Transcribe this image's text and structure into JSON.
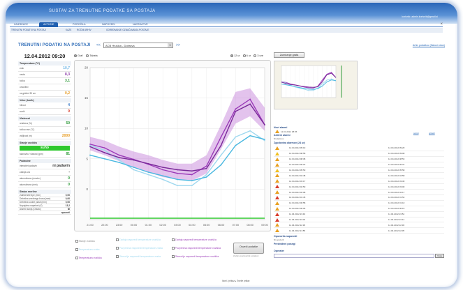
{
  "header": {
    "app_title": "SUSTAV ZA TRENUTNE PODATKE SA POSTAJA",
    "user_info": "korisnik: admin.korisnik@gmail.si"
  },
  "nav": {
    "items": [
      "ZAJEDNICE",
      "AKTIVNE",
      "POROČILA",
      "NAPOVEDI",
      "NASTAVITVE"
    ],
    "active": 1,
    "close": "×"
  },
  "subnav": {
    "items": [
      "TRENUTNI PODATKI NA POSTAJI",
      "KAZE",
      "ROČNI ARHIV",
      "ODREĐIVANJE OZNAČAVANJA POSTAJE"
    ]
  },
  "main": {
    "title": "TRENUTNI PODATKI NA POSTAJI",
    "prev": "<<",
    "next": ">>",
    "station": "ACB Hrušica - Dobrava",
    "archive_link": "Arhiv podatkov (Nalozi stran)",
    "view_options": [
      "Graf",
      "Tabela"
    ],
    "range_options": [
      "12 ur",
      "6 ur",
      "3 ure"
    ]
  },
  "left": {
    "datetime": "12.04.2012 09:20",
    "groups": [
      {
        "title": "Temperatura (°C)",
        "rows": [
          {
            "label": "zrak",
            "value": "10,7",
            "color": "#6fb6e6"
          },
          {
            "label": "cesta",
            "value": "8,3",
            "color": "#8a3aa8"
          },
          {
            "label": "točka",
            "value": "3,1",
            "color": "#2e9a3a"
          },
          {
            "label": "omočitev",
            "value": "",
            "color": "#333"
          },
          {
            "label": "na globini 30 cm",
            "value": "0,2",
            "color": "#e69a20"
          }
        ]
      },
      {
        "title": "Veter (km/h)",
        "rows": [
          {
            "label": "hitrost",
            "value": "4",
            "color": "#3a7ac8"
          },
          {
            "label": "sunki",
            "value": "9",
            "color": "#d83a2a"
          }
        ]
      },
      {
        "title": "Vlažnost",
        "rows": [
          {
            "label": "relativna (%)",
            "value": "59",
            "color": "#2e9a3a"
          },
          {
            "label": "točka rose (°C)",
            "value": "",
            "color": "#333"
          },
          {
            "label": "vidljivost (m)",
            "value": "2000",
            "color": "#e69a20"
          }
        ]
      },
      {
        "title": "Stanje vozišča",
        "rows": []
      }
    ],
    "road_state": "suho",
    "road_rows": [
      {
        "label": "stanovito / slanost (g/m)",
        "value": "81",
        "color": "#2e9a3a"
      }
    ],
    "precip": {
      "title": "Padavine",
      "rows": [
        {
          "label": "intenzitet padavin",
          "value": "ni padavin",
          "color": "#333"
        },
        {
          "label": "zadnja ura",
          "value": "-",
          "color": "#333"
        },
        {
          "label": "akumulirano (mm/m²)",
          "value": "0",
          "color": "#2e9a3a"
        },
        {
          "label": "akumulirano (mm)",
          "value": "0",
          "color": "#2e9a3a"
        }
      ]
    },
    "status": {
      "title": "Status merilne",
      "rows": [
        {
          "label": "Zaledenele tipe (mm)",
          "value": "0,00"
        },
        {
          "label": "Debelina snežnega krova (mm)",
          "value": "0,00"
        },
        {
          "label": "Debelina vodne plasti (mm)",
          "value": "0,00"
        },
        {
          "label": "Napajalna napetost (V)",
          "value": "13,2"
        },
        {
          "label": "Alarmi stanja (Ostalo)",
          "value": "NI"
        },
        {
          "label": "",
          "value": "opozoril"
        }
      ]
    }
  },
  "chart_data": {
    "type": "line",
    "ylim": [
      -5,
      20
    ],
    "yticks": [
      0,
      5,
      10,
      15,
      20
    ],
    "x": [
      "21:00",
      "22:00",
      "23:00",
      "00:00",
      "01:00",
      "02:00",
      "03:00",
      "04:00",
      "05:00",
      "06:00",
      "07:00",
      "08:00",
      "09:00"
    ],
    "series": [
      {
        "name": "Zadnja naporedi temperature vozišča",
        "color": "#9a3ab8",
        "values": [
          7.4,
          6.8,
          5.6,
          4.9,
          4.1,
          3.2,
          2.6,
          2.4,
          3.8,
          8.6,
          13.2,
          14.8,
          10.6
        ]
      },
      {
        "name": "Temperatura zraka",
        "color": "#9fd8ef",
        "values": [
          7.2,
          6.4,
          4.8,
          3.2,
          2.4,
          1.6,
          0.6,
          0.6,
          2.4,
          5.6,
          8.6,
          9.6,
          8.0
        ]
      },
      {
        "name": "Temperatura vozišča",
        "color": "#7a2a9a",
        "values": [
          7.0,
          6.0,
          5.2,
          4.8,
          4.2,
          3.6,
          3.2,
          3.0,
          3.4,
          7.2,
          12.8,
          14.0,
          10.6
        ]
      },
      {
        "name": "Rosišče",
        "color": "#4ab8e0",
        "values": [
          5.6,
          5.0,
          4.4,
          3.6,
          2.8,
          2.2,
          1.6,
          1.4,
          2.0,
          4.0,
          7.2,
          8.8,
          8.2
        ]
      }
    ],
    "band_upper": [
      8.6,
      8.0,
      7.0,
      6.2,
      5.6,
      4.8,
      4.2,
      4.2,
      5.6,
      10.6,
      16.0,
      16.6,
      13.4
    ],
    "band_lower": [
      6.4,
      5.6,
      4.6,
      3.6,
      2.8,
      2.0,
      1.6,
      1.4,
      2.6,
      6.6,
      10.8,
      12.0,
      9.6
    ]
  },
  "legend": {
    "items": [
      "Stanje vozišča",
      "Zadnja naporedi temperature vozišča",
      "Zadnja naporedi temperature vozišča",
      "Temperatura zraka",
      "Povprečna naporedi temperature zraka",
      "Povprečna naporedi temperature vozišča",
      "Temperatura vozišča",
      "Območje naporedi temperature zraka",
      "Območje naporedi temperature vozišča"
    ],
    "close_button": "Osveži podatke",
    "close_note": "Zadnji osveževalnik podatkov"
  },
  "pager": "Ikoni / prikaz ▸ Sveže prikaz",
  "right": {
    "zoom_button": "Zumiranje grafa",
    "alerts_title": "Novi alarmi",
    "alert_first": "12.04.2012 08:35",
    "alert_links": [
      "potrdi",
      "prikaži"
    ],
    "active_title": "Aktivni alarmi",
    "active_sub": "Ni alarmov",
    "history_title": "Zgodovina alarmov (24 ur)",
    "history": [
      {
        "sev": "orange",
        "t1": "12.04.2012 09:19",
        "t2": "12.04.2012 09:20"
      },
      {
        "sev": "yellow",
        "t1": "12.04.2012 08:58",
        "t2": "12.04.2012 09:08"
      },
      {
        "sev": "orange",
        "t1": "12.04.2012 08:38",
        "t2": "12.04.2012 08:53"
      },
      {
        "sev": "orange",
        "t1": "12.04.2012 06:22",
        "t2": "12.04.2012 06:31"
      },
      {
        "sev": "yellow",
        "t1": "12.04.2012 05:50",
        "t2": "12.04.2012 05:58"
      },
      {
        "sev": "orange",
        "t1": "12.04.2012 04:48",
        "t2": "12.04.2012 04:58"
      },
      {
        "sev": "orange",
        "t1": "12.04.2012 03:17",
        "t2": "12.04.2012 03:30"
      },
      {
        "sev": "red",
        "t1": "12.04.2012 02:50",
        "t2": "12.04.2012 03:00"
      },
      {
        "sev": "orange",
        "t1": "12.04.2012 02:08",
        "t2": "12.04.2012 02:17"
      },
      {
        "sev": "red",
        "t1": "12.04.2012 01:45",
        "t2": "12.04.2012 01:52"
      },
      {
        "sev": "orange",
        "t1": "12.04.2012 00:58",
        "t2": "12.04.2012 01:10"
      },
      {
        "sev": "orange",
        "t1": "12.04.2012 00:05",
        "t2": "12.04.2012 00:15"
      },
      {
        "sev": "red",
        "t1": "11.04.2012 23:40",
        "t2": "11.04.2012 23:52"
      },
      {
        "sev": "red",
        "t1": "11.04.2012 23:02",
        "t2": "11.04.2012 23:12"
      },
      {
        "sev": "orange",
        "t1": "11.04.2012 22:18",
        "t2": "11.04.2012 22:30"
      },
      {
        "sev": "orange",
        "t1": "11.04.2012 21:55",
        "t2": "11.04.2012 22:05"
      }
    ],
    "notes_title": "Opozorila napovedi",
    "notes_sub": "Ni opozoril",
    "forecast_title": "Predvideni posegi",
    "operator_title": "Operater",
    "send": "Vnos"
  }
}
